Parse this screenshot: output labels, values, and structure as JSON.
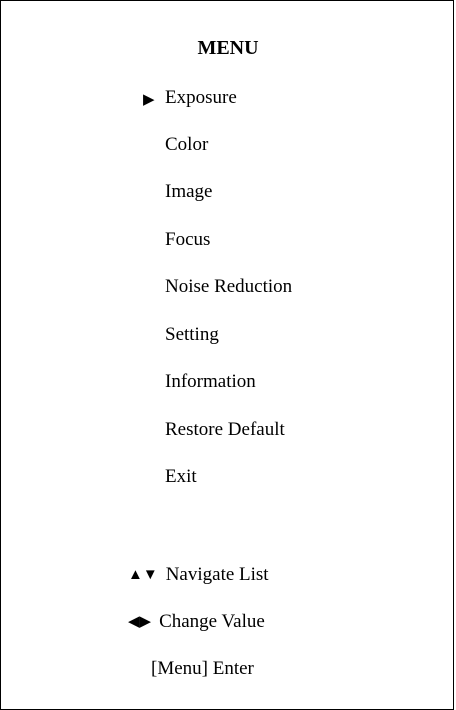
{
  "menu": {
    "title": "MENU",
    "selected_index": 0,
    "cursor_glyph": "▶",
    "items": [
      {
        "label": "Exposure",
        "name": "menu-item-exposure"
      },
      {
        "label": "Color",
        "name": "menu-item-color"
      },
      {
        "label": "Image",
        "name": "menu-item-image"
      },
      {
        "label": "Focus",
        "name": "menu-item-focus"
      },
      {
        "label": "Noise Reduction",
        "name": "menu-item-noise-reduction"
      },
      {
        "label": "Setting",
        "name": "menu-item-setting"
      },
      {
        "label": "Information",
        "name": "menu-item-information"
      },
      {
        "label": "Restore Default",
        "name": "menu-item-restore-default"
      },
      {
        "label": "Exit",
        "name": "menu-item-exit"
      }
    ]
  },
  "hints": {
    "navigate": {
      "glyph": "▲▼",
      "label": "Navigate List",
      "icon": "up-down-arrows-icon"
    },
    "change": {
      "glyph": "◀▶",
      "label": "Change Value",
      "icon": "left-right-arrows-icon"
    },
    "enter": {
      "label": "[Menu] Enter"
    }
  }
}
